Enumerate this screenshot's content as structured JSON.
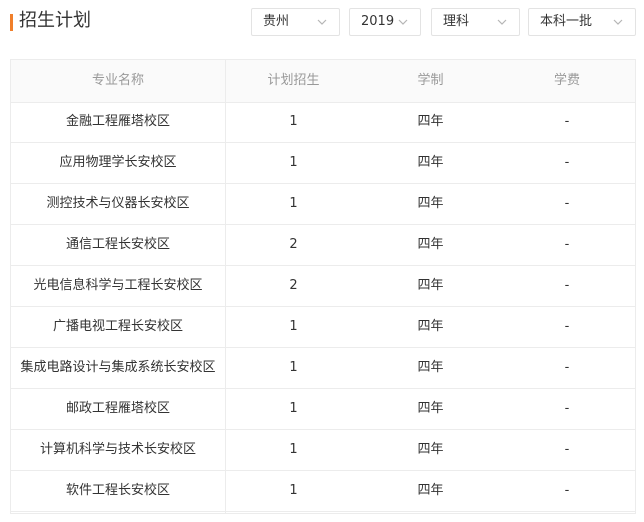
{
  "header": {
    "title": "招生计划",
    "accent_color": "#f07f2a"
  },
  "filters": {
    "province": "贵州",
    "year": "2019",
    "subject": "理科",
    "batch": "本科一批",
    "chevron_icon": "chevron-down-icon"
  },
  "table": {
    "columns": [
      "专业名称",
      "计划招生",
      "学制",
      "学费"
    ],
    "rows": [
      [
        "金融工程雁塔校区",
        "1",
        "四年",
        "-"
      ],
      [
        "应用物理学长安校区",
        "1",
        "四年",
        "-"
      ],
      [
        "测控技术与仪器长安校区",
        "1",
        "四年",
        "-"
      ],
      [
        "通信工程长安校区",
        "2",
        "四年",
        "-"
      ],
      [
        "光电信息科学与工程长安校区",
        "2",
        "四年",
        "-"
      ],
      [
        "广播电视工程长安校区",
        "1",
        "四年",
        "-"
      ],
      [
        "集成电路设计与集成系统长安校区",
        "1",
        "四年",
        "-"
      ],
      [
        "邮政工程雁塔校区",
        "1",
        "四年",
        "-"
      ],
      [
        "计算机科学与技术长安校区",
        "1",
        "四年",
        "-"
      ],
      [
        "软件工程长安校区",
        "1",
        "四年",
        "-"
      ]
    ]
  }
}
